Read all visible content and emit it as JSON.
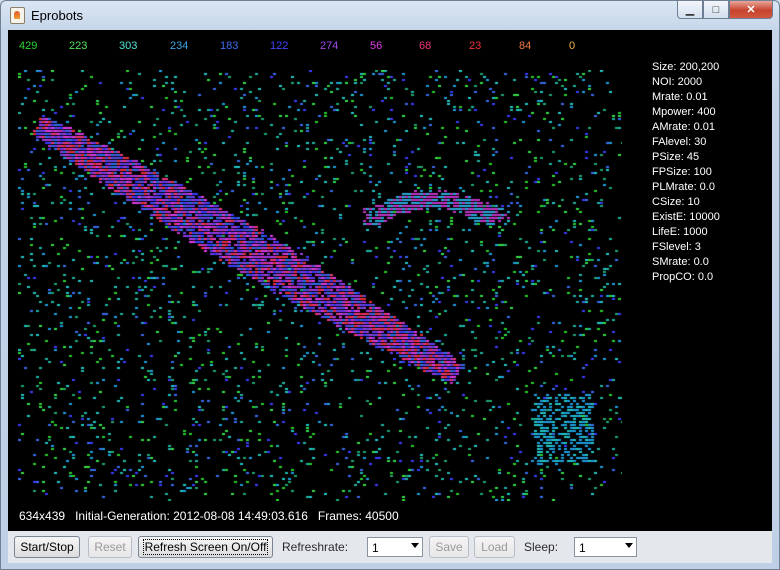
{
  "window": {
    "title": "Eprobots",
    "icon": "java-app-icon"
  },
  "counts": [
    {
      "value": "429",
      "color": "#2dd62d"
    },
    {
      "value": "223",
      "color": "#5ae25a"
    },
    {
      "value": "303",
      "color": "#52e5d8"
    },
    {
      "value": "234",
      "color": "#3aa6e4"
    },
    {
      "value": "183",
      "color": "#3f6ef0"
    },
    {
      "value": "122",
      "color": "#4446ff"
    },
    {
      "value": "274",
      "color": "#a04de6"
    },
    {
      "value": "56",
      "color": "#e03ce6"
    },
    {
      "value": "68",
      "color": "#f0347a"
    },
    {
      "value": "23",
      "color": "#f0343c"
    },
    {
      "value": "84",
      "color": "#f07a45"
    },
    {
      "value": "0",
      "color": "#f0b34d"
    }
  ],
  "params": [
    "Size: 200,200",
    "NOI: 2000",
    "Mrate: 0.01",
    "Mpower: 400",
    "AMrate: 0.01",
    "FAlevel: 30",
    "PSize: 45",
    "FPSize: 100",
    "PLMrate: 0.0",
    "CSize: 10",
    "ExistE: 10000",
    "LifeE: 1000",
    "FSlevel: 3",
    "SMrate: 0.0",
    "PropCO: 0.0"
  ],
  "status": {
    "dimensions": "634x439",
    "initial_generation": "Initial-Generation: 2012-08-08 14:49:03.616",
    "frames": "Frames: 40500"
  },
  "toolbar": {
    "start_stop": "Start/Stop",
    "reset": "Reset",
    "refresh_toggle": "Refresh Screen On/Off",
    "refreshrate_label": "Refreshrate:",
    "refreshrate_value": "1",
    "save": "Save",
    "load": "Load",
    "sleep_label": "Sleep:",
    "sleep_value": "1"
  }
}
